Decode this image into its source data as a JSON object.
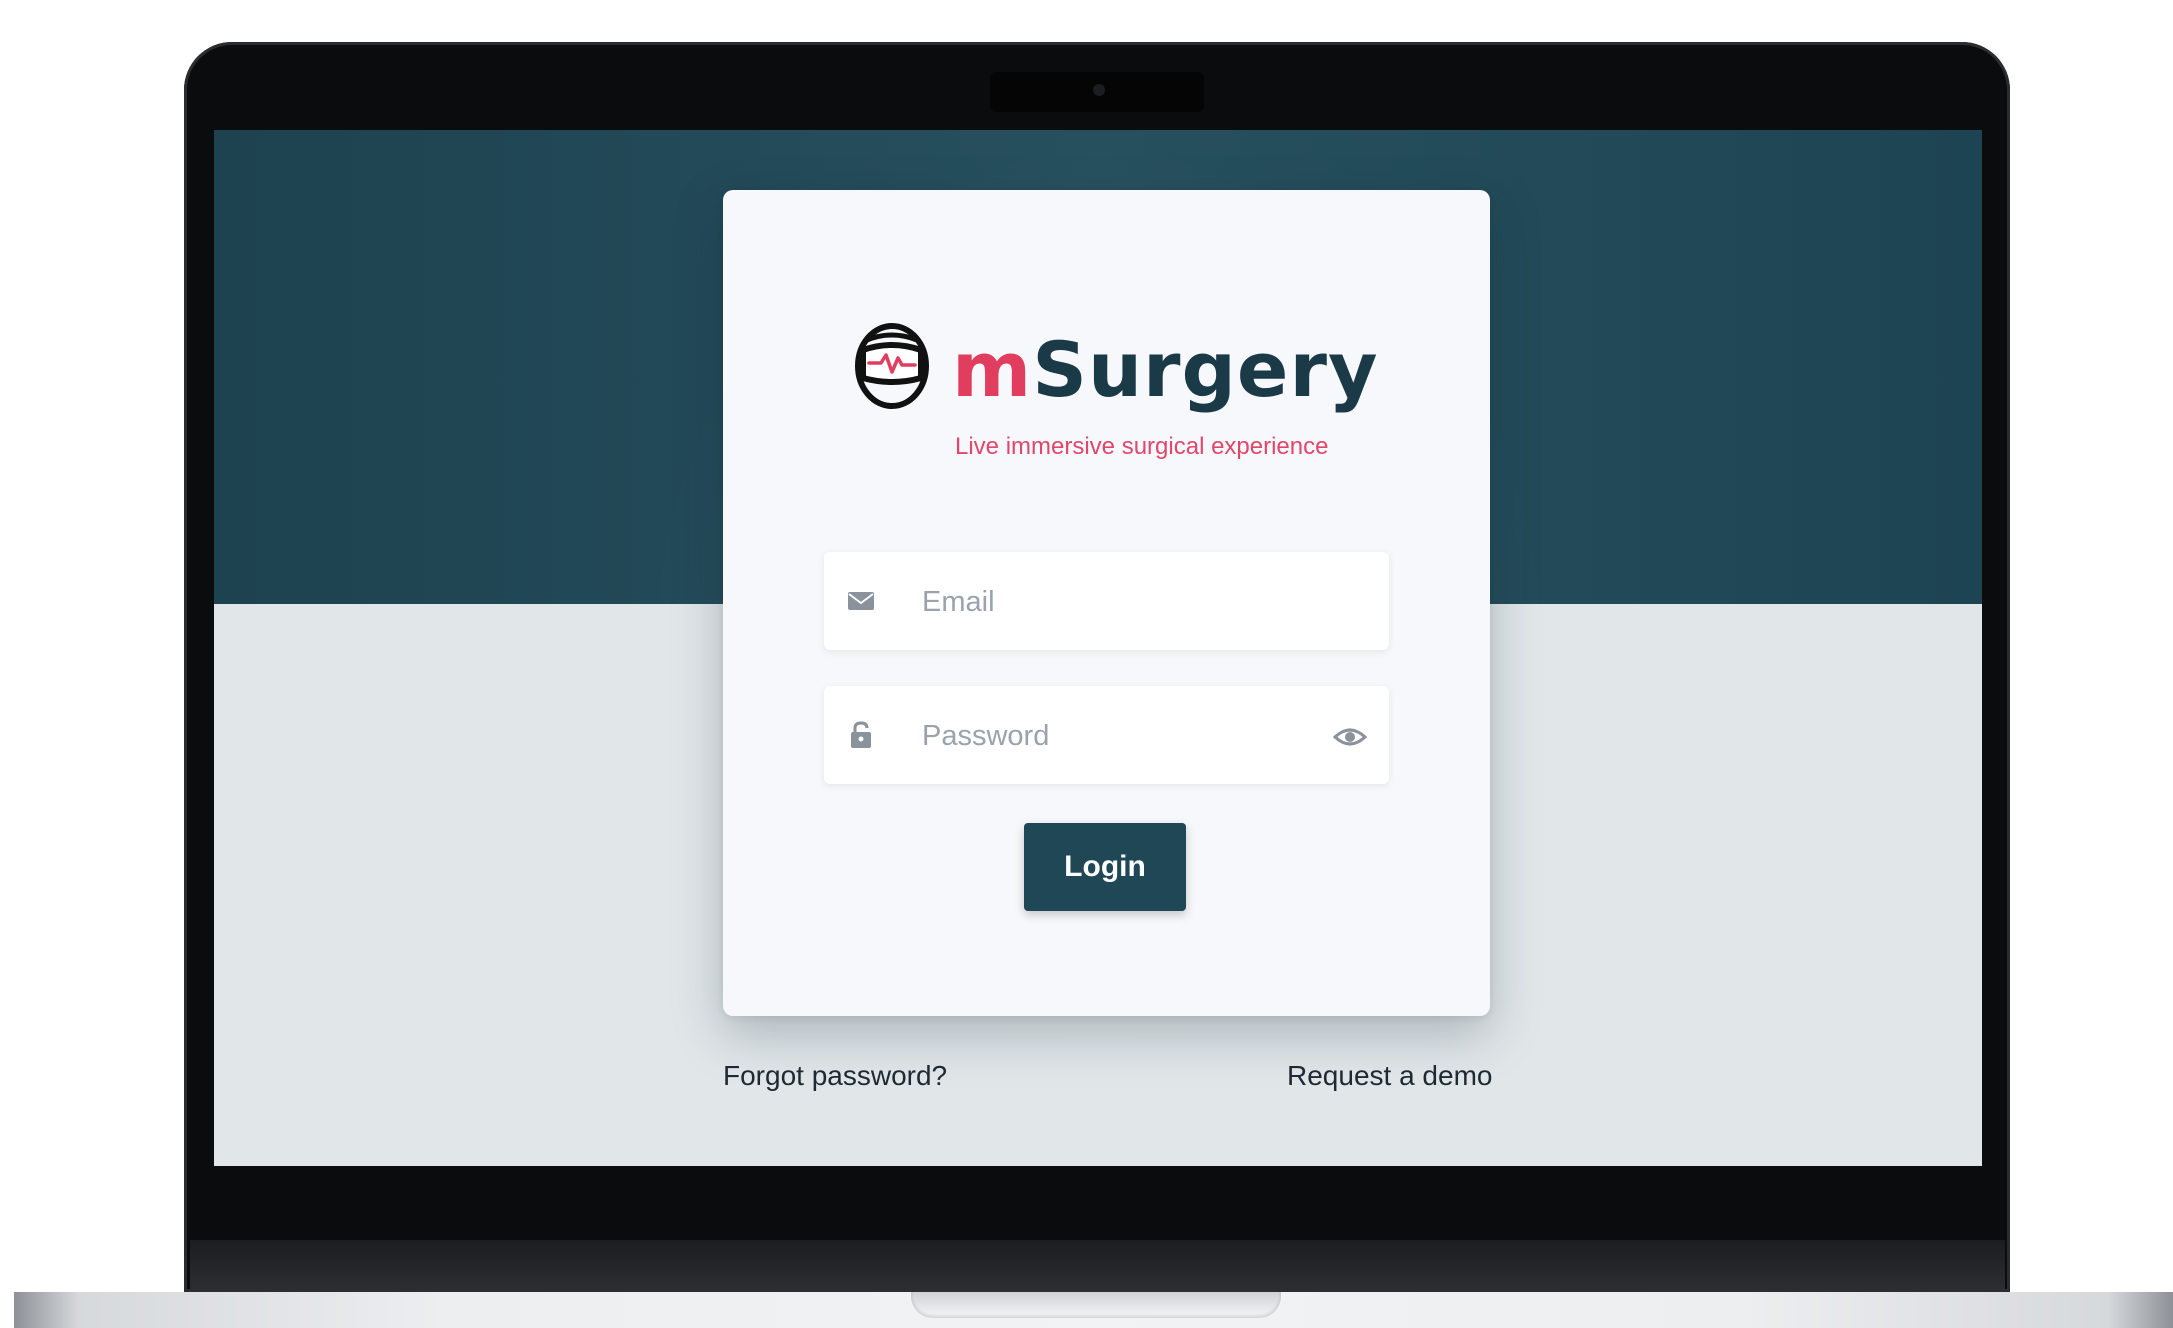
{
  "app": {
    "brand_prefix": "m",
    "brand_suffix": "Surgery",
    "tagline": "Live immersive surgical experience",
    "logo_icon": "vr-headset-icon"
  },
  "login_form": {
    "email": {
      "placeholder": "Email",
      "value": "",
      "icon": "envelope-icon"
    },
    "password": {
      "placeholder": "Password",
      "value": "",
      "icon": "lock-icon",
      "toggle_icon": "eye-icon"
    },
    "login_label": "Login"
  },
  "links": {
    "forgot_password": "Forgot password?",
    "request_demo": "Request a demo"
  },
  "colors": {
    "brand_accent": "#e03d5f",
    "brand_dark": "#1b3a48",
    "header_band": "#1f4755",
    "page_background": "#e1e6e9"
  }
}
